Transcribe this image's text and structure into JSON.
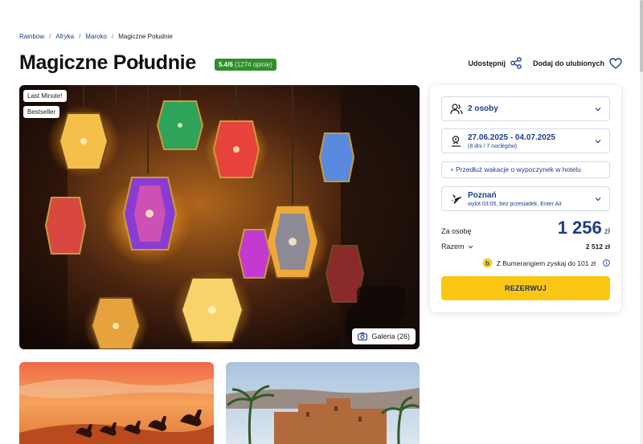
{
  "breadcrumb": [
    "Rainbow",
    "Afryka",
    "Maroko",
    "Magiczne Południe"
  ],
  "title": "Magiczne Południe",
  "rating": {
    "score": "5.4/6",
    "reviews": "(1274 opinie)"
  },
  "actions": {
    "share": "Udostępnij",
    "favorite": "Dodaj do ulubionych"
  },
  "hero": {
    "tag1": "Last Minute!",
    "tag2": "Bestseller",
    "gallery": "Galeria (26)"
  },
  "booking": {
    "persons": "2 osoby",
    "dates": "27.06.2025 - 04.07.2025",
    "dates_sub": "(8 dni / 7 noclegów)",
    "extend": "Przedłuż wakacje o wypoczynek w hotelu",
    "departure": "Poznań",
    "departure_sub": "wylot 03:05, bez przesiadek, Enter Air",
    "per_person_label": "Za osobę",
    "per_person_price": "1 256",
    "currency": "zł",
    "total_label": "Razem",
    "total_value": "2 512 zł",
    "boomerang": "Z Bumerangiem zyskaj do 101 zł",
    "reserve": "REZERWUJ"
  },
  "colors": {
    "brand_blue": "#1b3d8a",
    "accent_yellow": "#fcc614",
    "rating_green": "#2f8f2a"
  },
  "icons": [
    "share-icon",
    "heart-icon",
    "camera-icon",
    "persons-icon",
    "calendar-icon",
    "plane-icon",
    "chevron-down-icon",
    "bumerang-icon",
    "info-icon"
  ]
}
